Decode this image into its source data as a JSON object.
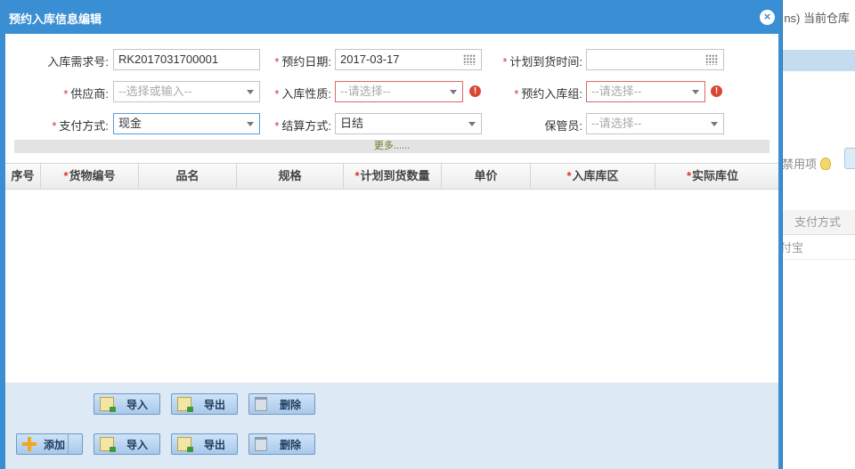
{
  "background": {
    "crumb": "ns) 当前仓库",
    "filter_label": "禁用项",
    "column_header": "支付方式",
    "cell_value": "付宝"
  },
  "dialog": {
    "title": "预约入库信息编辑",
    "close_glyph": "×"
  },
  "form": {
    "request_no": {
      "label": "入库需求号:",
      "value": "RK2017031700001",
      "required": false
    },
    "appt_date": {
      "label": "预约日期:",
      "value": "2017-03-17",
      "required": true
    },
    "plan_time": {
      "label": "计划到货时间:",
      "value": "",
      "required": true
    },
    "supplier": {
      "label": "供应商:",
      "placeholder": "--选择或输入--",
      "required": true
    },
    "in_type": {
      "label": "入库性质:",
      "placeholder": "--请选择--",
      "required": true,
      "error": true
    },
    "in_group": {
      "label": "预约入库组:",
      "placeholder": "--请选择--",
      "required": true,
      "error": true
    },
    "pay_method": {
      "label": "支付方式:",
      "value": "现金",
      "required": true
    },
    "settle_method": {
      "label": "结算方式:",
      "value": "日结",
      "required": true
    },
    "keeper": {
      "label": "保管员:",
      "placeholder": "--请选择--",
      "required": false
    },
    "more_label": "更多......"
  },
  "grid": {
    "columns": [
      {
        "label": "序号",
        "required": false
      },
      {
        "label": "货物编号",
        "required": true
      },
      {
        "label": "品名",
        "required": false
      },
      {
        "label": "规格",
        "required": false
      },
      {
        "label": "计划到货数量",
        "required": true
      },
      {
        "label": "单价",
        "required": false
      },
      {
        "label": "入库库区",
        "required": true
      },
      {
        "label": "实际库位",
        "required": true
      }
    ],
    "rows": []
  },
  "toolbar": {
    "import_label": "导入",
    "export_label": "导出",
    "delete_label": "删除",
    "add_label": "添加"
  },
  "colors": {
    "header_blue": "#3a8ed3",
    "toolbar_bg": "#dde9f4",
    "required_red": "#d9322f"
  }
}
